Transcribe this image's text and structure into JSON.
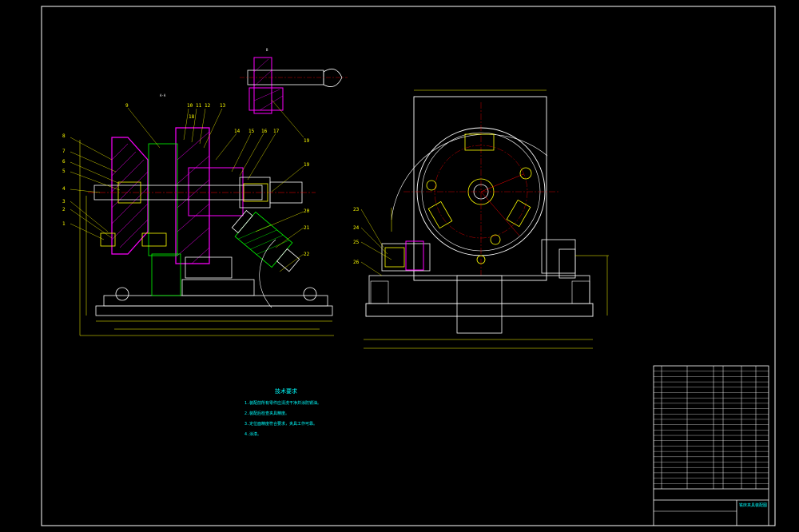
{
  "drawing": {
    "background": "#000000",
    "colors": {
      "frame": "#ffffff",
      "outline": "#ffffff",
      "dimension": "#ffff00",
      "section": "#ff00ff",
      "center": "#ff0000",
      "part_line": "#00ff00",
      "note_text": "#00ffff",
      "hatch": "#00ffff"
    },
    "view_labels": {
      "section_aa": "A-A",
      "detail_b": "B"
    },
    "balloons_left": [
      "9",
      "10",
      "11",
      "12",
      "13",
      "14",
      "15",
      "16",
      "17",
      "18",
      "8",
      "7",
      "6",
      "5",
      "4",
      "3",
      "2",
      "1",
      "19",
      "20",
      "21",
      "22"
    ],
    "balloons_right": [
      "23",
      "24",
      "25",
      "26"
    ],
    "technical_requirements": {
      "title": "技术要求",
      "items": [
        "1.装配前所有零件应清洗干净并涂防锈油。",
        "2.装配后检查夹具精度。",
        "3.定位面精度符合要求，夹具工作可靠。",
        "4.涂漆。"
      ]
    },
    "title_block": {
      "drawing_title": "铣床夹具装配图",
      "rows": 23
    }
  }
}
